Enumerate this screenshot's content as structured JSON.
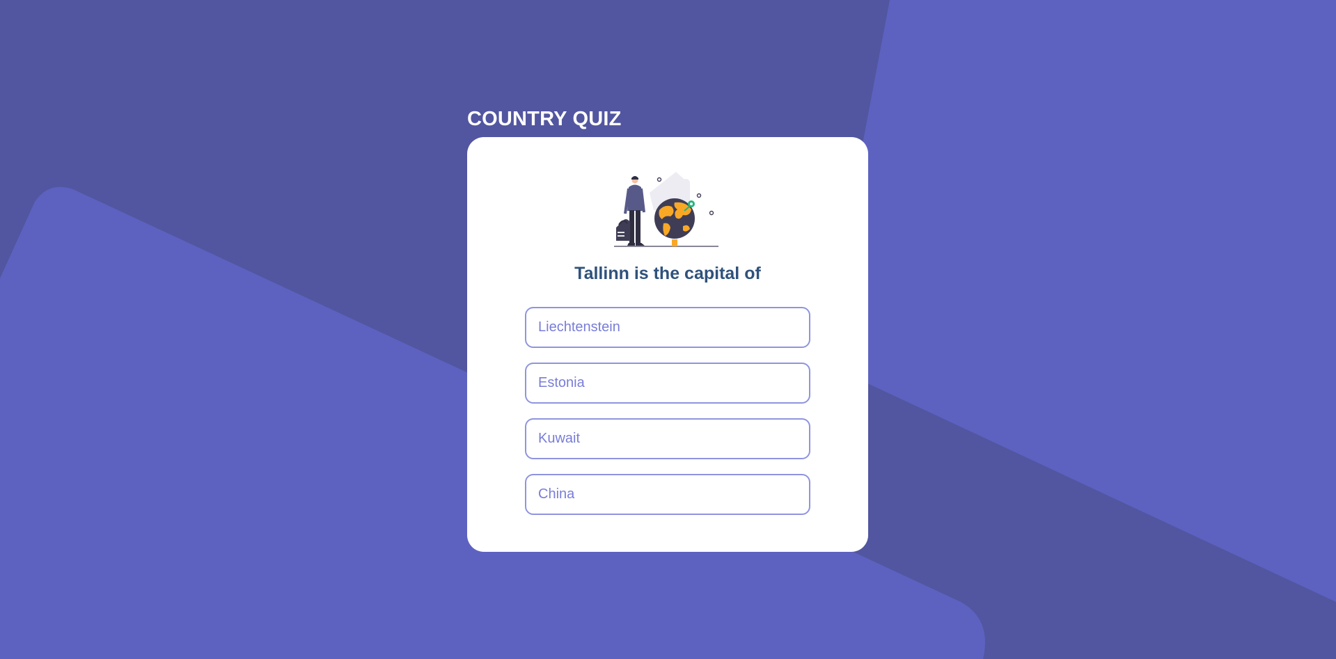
{
  "app": {
    "title": "COUNTRY QUIZ"
  },
  "colors": {
    "background": "#5256a0",
    "background_shapes": "#5d62c1",
    "card": "#ffffff",
    "title": "#ffffff",
    "question": "#2f527b",
    "option_accent": "#6066d0",
    "globe_orange": "#f9a826",
    "globe_dark": "#3f3d56",
    "pin_teal": "#24b47e"
  },
  "illustration": {
    "icon": "traveler-globe-illustration"
  },
  "question": {
    "text": "Tallinn is the capital of"
  },
  "options": [
    {
      "label": "Liechtenstein"
    },
    {
      "label": "Estonia"
    },
    {
      "label": "Kuwait"
    },
    {
      "label": "China"
    }
  ]
}
